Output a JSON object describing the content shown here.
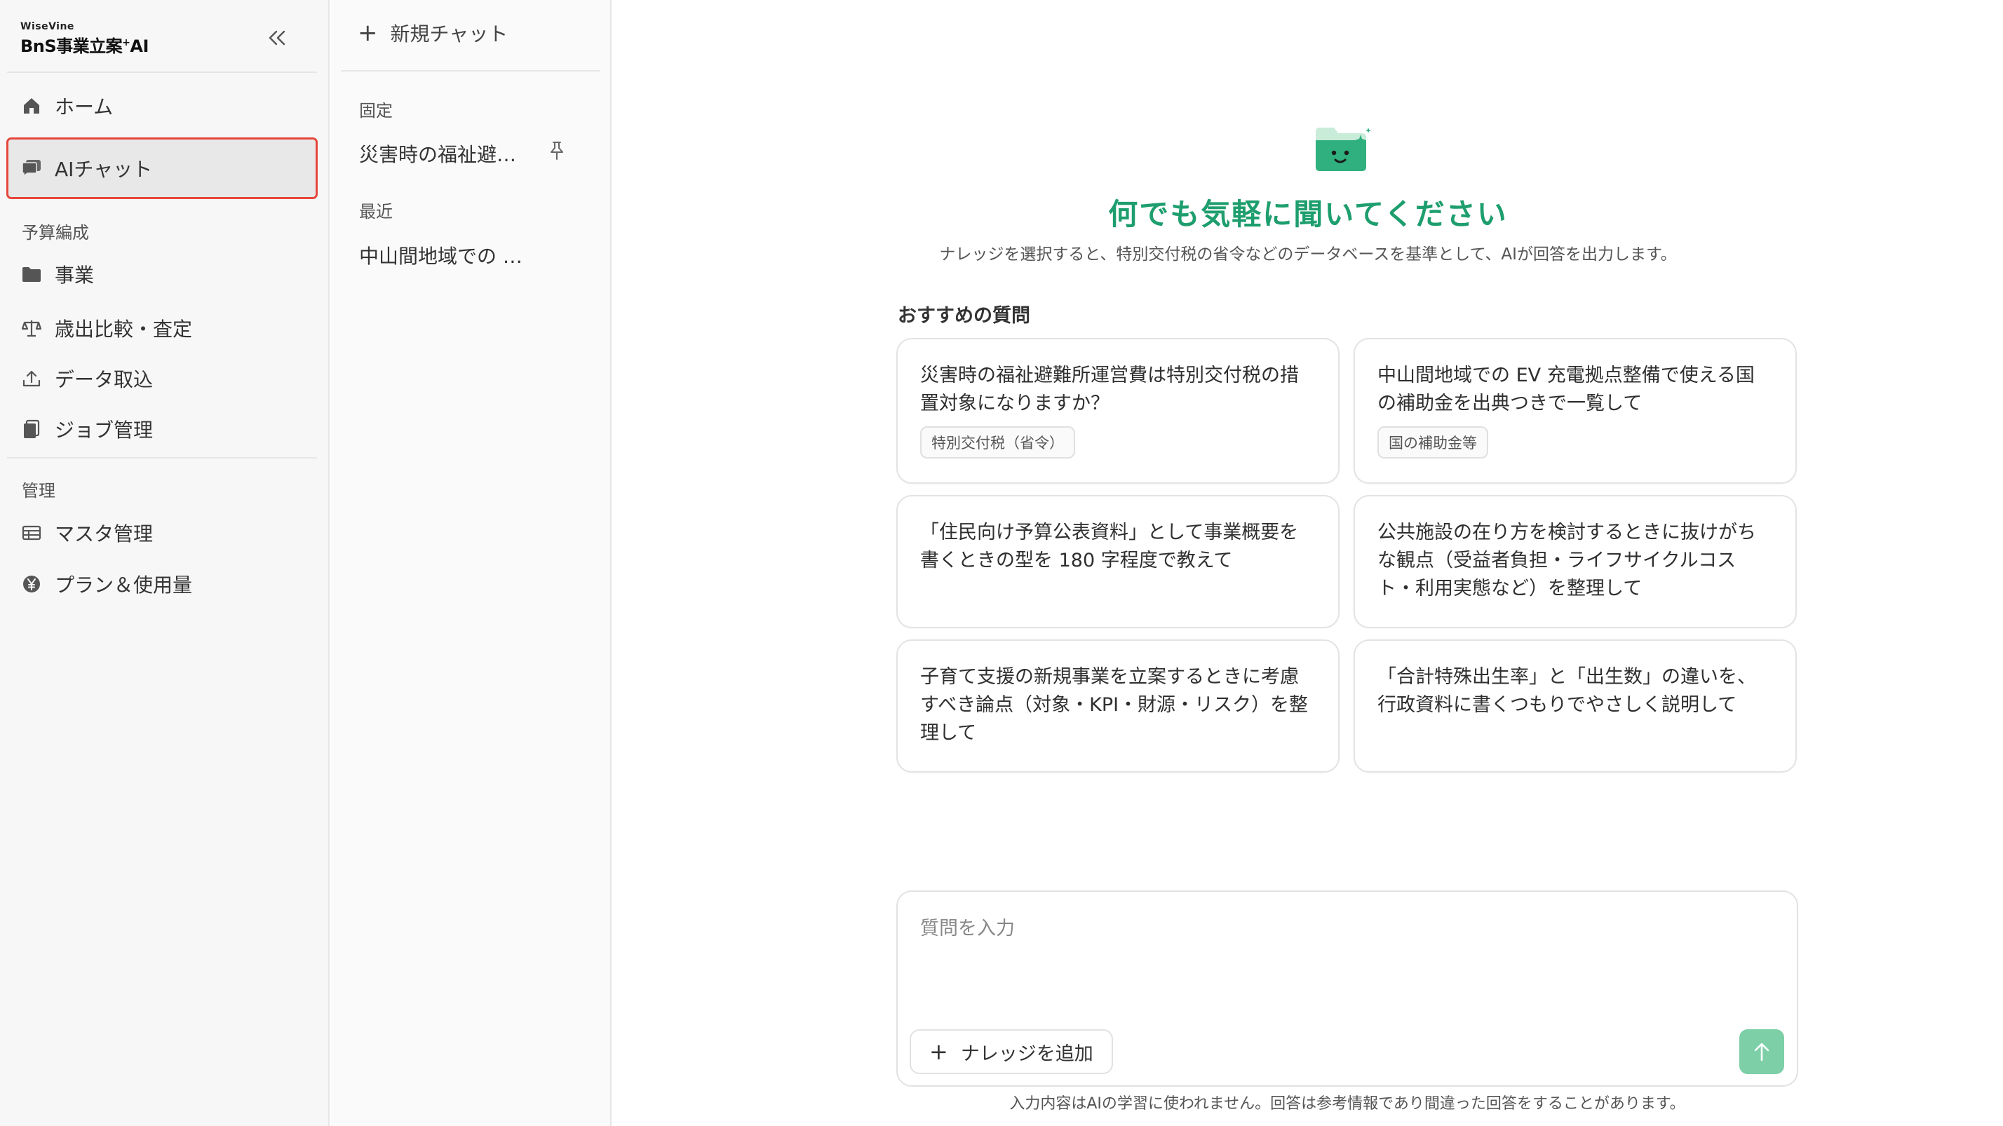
{
  "brand": {
    "small": "WiseVine",
    "main": "BnS事業立案",
    "plus": "+",
    "ai": "AI"
  },
  "colors": {
    "accent": "#1e9e6e",
    "highlight": "#e5463a",
    "send_button": "#7ccfa6"
  },
  "sidebar": {
    "collapse_icon": "double-chevron-left-icon",
    "items": [
      {
        "label": "ホーム",
        "icon": "home-icon"
      },
      {
        "label": "AIチャット",
        "icon": "chat-bubbles-icon",
        "active": true
      }
    ],
    "sections": [
      {
        "label": "予算編成",
        "items": [
          {
            "label": "事業",
            "icon": "folder-icon"
          },
          {
            "label": "歳出比較・査定",
            "icon": "scale-icon"
          },
          {
            "label": "データ取込",
            "icon": "upload-icon"
          },
          {
            "label": "ジョブ管理",
            "icon": "clipboard-icon"
          }
        ]
      },
      {
        "label": "管理",
        "items": [
          {
            "label": "マスタ管理",
            "icon": "table-icon"
          },
          {
            "label": "プラン＆使用量",
            "icon": "yen-icon"
          }
        ]
      }
    ]
  },
  "history": {
    "new_chat": "新規チャット",
    "pinned_label": "固定",
    "pinned": [
      {
        "title": "災害時の福祉避…",
        "icon": "pin-icon"
      }
    ],
    "recent_label": "最近",
    "recent": [
      {
        "title": "中山間地域での …"
      }
    ]
  },
  "main": {
    "hero_icon": "smiling-folder-sparkle-icon",
    "title": "何でも気軽に聞いてください",
    "subtitle": "ナレッジを選択すると、特別交付税の省令などのデータベースを基準として、AIが回答を出力します。",
    "recommend_title": "おすすめの質問",
    "cards": [
      {
        "text": "災害時の福祉避難所運営費は特別交付税の措置対象になりますか？",
        "tag": "特別交付税（省令）"
      },
      {
        "text": "中山間地域での EV 充電拠点整備で使える国の補助金を出典つきで一覧して",
        "tag": "国の補助金等"
      },
      {
        "text": "「住民向け予算公表資料」として事業概要を書くときの型を 180 字程度で教えて",
        "tag": ""
      },
      {
        "text": "公共施設の在り方を検討するときに抜けがちな観点（受益者負担・ライフサイクルコスト・利用実態など）を整理して",
        "tag": ""
      },
      {
        "text": "子育て支援の新規事業を立案するときに考慮すべき論点（対象・KPI・財源・リスク）を整理して",
        "tag": ""
      },
      {
        "text": "「合計特殊出生率」と「出生数」の違いを、行政資料に書くつもりでやさしく説明して",
        "tag": ""
      }
    ],
    "input": {
      "placeholder": "質問を入力",
      "value": "",
      "add_knowledge": "ナレッジを追加",
      "send_icon": "arrow-up-icon"
    },
    "disclaimer": "入力内容はAIの学習に使われません。回答は参考情報であり間違った回答をすることがあります。"
  }
}
